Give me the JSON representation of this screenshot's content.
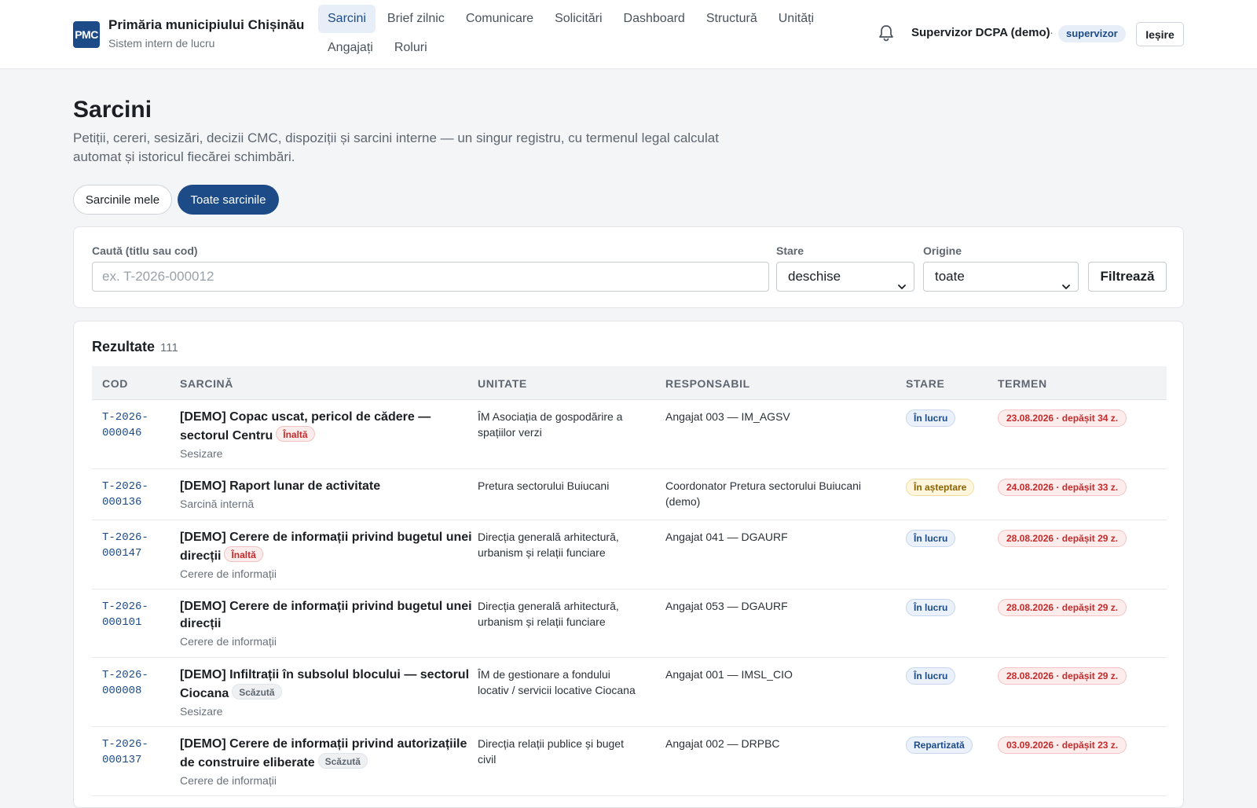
{
  "header": {
    "logo_text": "PMC",
    "title": "Primăria municipiului Chișinău",
    "subtitle": "Sistem intern de lucru",
    "nav": [
      {
        "label": "Sarcini",
        "active": true
      },
      {
        "label": "Brief zilnic",
        "active": false
      },
      {
        "label": "Comunicare",
        "active": false
      },
      {
        "label": "Solicitări",
        "active": false
      },
      {
        "label": "Dashboard",
        "active": false
      },
      {
        "label": "Structură",
        "active": false
      },
      {
        "label": "Unități",
        "active": false
      },
      {
        "label": "Angajați",
        "active": false
      },
      {
        "label": "Roluri",
        "active": false
      }
    ],
    "user_name": "Supervizor DCPA (demo)",
    "separator": "·",
    "role": "supervizor",
    "logout_label": "Ieșire"
  },
  "page": {
    "title": "Sarcini",
    "description": "Petiții, cereri, sesizări, decizii CMC, dispoziții și sarcini interne — un singur registru, cu termenul legal calculat automat și istoricul fiecărei schimbări.",
    "toggle_mine": "Sarcinile mele",
    "toggle_all": "Toate sarcinile",
    "toggle_active": "all"
  },
  "filters": {
    "search_label": "Caută (titlu sau cod)",
    "search_placeholder": "ex. T-2026-000012",
    "search_value": "",
    "state_label": "Stare",
    "state_value": "deschise",
    "origin_label": "Origine",
    "origin_value": "toate",
    "submit_label": "Filtrează"
  },
  "results": {
    "title": "Rezultate",
    "count": "111",
    "columns": [
      "COD",
      "SARCINĂ",
      "UNITATE",
      "RESPONSABIL",
      "STARE",
      "TERMEN"
    ],
    "rows": [
      {
        "code": "T-2026-\n000046",
        "title": "[DEMO] Copac uscat, pericol de cădere — sectorul Centru",
        "priority": "Înaltă",
        "priority_level": "high",
        "type": "Sesizare",
        "unit": "ÎM Asociația de gospodărire a spațiilor verzi",
        "responsible": "Angajat 003 — IM_AGSV",
        "state": "În lucru",
        "state_kind": "work",
        "deadline": "23.08.2026 · depășit 34 z."
      },
      {
        "code": "T-2026-\n000136",
        "title": "[DEMO] Raport lunar de activitate",
        "priority": "",
        "priority_level": "",
        "type": "Sarcină internă",
        "unit": "Pretura sectorului Buiucani",
        "responsible": "Coordonator Pretura sectorului Buiucani (demo)",
        "state": "În așteptare",
        "state_kind": "wait",
        "deadline": "24.08.2026 · depășit 33 z."
      },
      {
        "code": "T-2026-\n000147",
        "title": "[DEMO] Cerere de informații privind bugetul unei direcții",
        "priority": "Înaltă",
        "priority_level": "high",
        "type": "Cerere de informații",
        "unit": "Direcția generală arhitectură, urbanism și relații funciare",
        "responsible": "Angajat 041 — DGAURF",
        "state": "În lucru",
        "state_kind": "work",
        "deadline": "28.08.2026 · depășit 29 z."
      },
      {
        "code": "T-2026-\n000101",
        "title": "[DEMO] Cerere de informații privind bugetul unei direcții",
        "priority": "",
        "priority_level": "",
        "type": "Cerere de informații",
        "unit": "Direcția generală arhitectură, urbanism și relații funciare",
        "responsible": "Angajat 053 — DGAURF",
        "state": "În lucru",
        "state_kind": "work",
        "deadline": "28.08.2026 · depășit 29 z."
      },
      {
        "code": "T-2026-\n000008",
        "title": "[DEMO] Infiltrații în subsolul blocului — sectorul Ciocana",
        "priority": "Scăzută",
        "priority_level": "low",
        "type": "Sesizare",
        "unit": "ÎM de gestionare a fondului locativ / servicii locative Ciocana",
        "responsible": "Angajat 001 — IMSL_CIO",
        "state": "În lucru",
        "state_kind": "work",
        "deadline": "28.08.2026 · depășit 29 z."
      },
      {
        "code": "T-2026-\n000137",
        "title": "[DEMO] Cerere de informații privind autorizațiile de construire eliberate",
        "priority": "Scăzută",
        "priority_level": "low",
        "type": "Cerere de informații",
        "unit": "Direcția relații publice și buget civil",
        "responsible": "Angajat 002 — DRPBC",
        "state": "Repartizată",
        "state_kind": "assign",
        "deadline": "03.09.2026 · depășit 23 z."
      }
    ]
  },
  "colors": {
    "brand": "#1c4b87",
    "danger": "#c42b2b",
    "warning": "#8a6200",
    "background": "#f4f5f6"
  },
  "icons": {
    "notifications": "bell-icon",
    "select": "chevron-down-icon"
  }
}
